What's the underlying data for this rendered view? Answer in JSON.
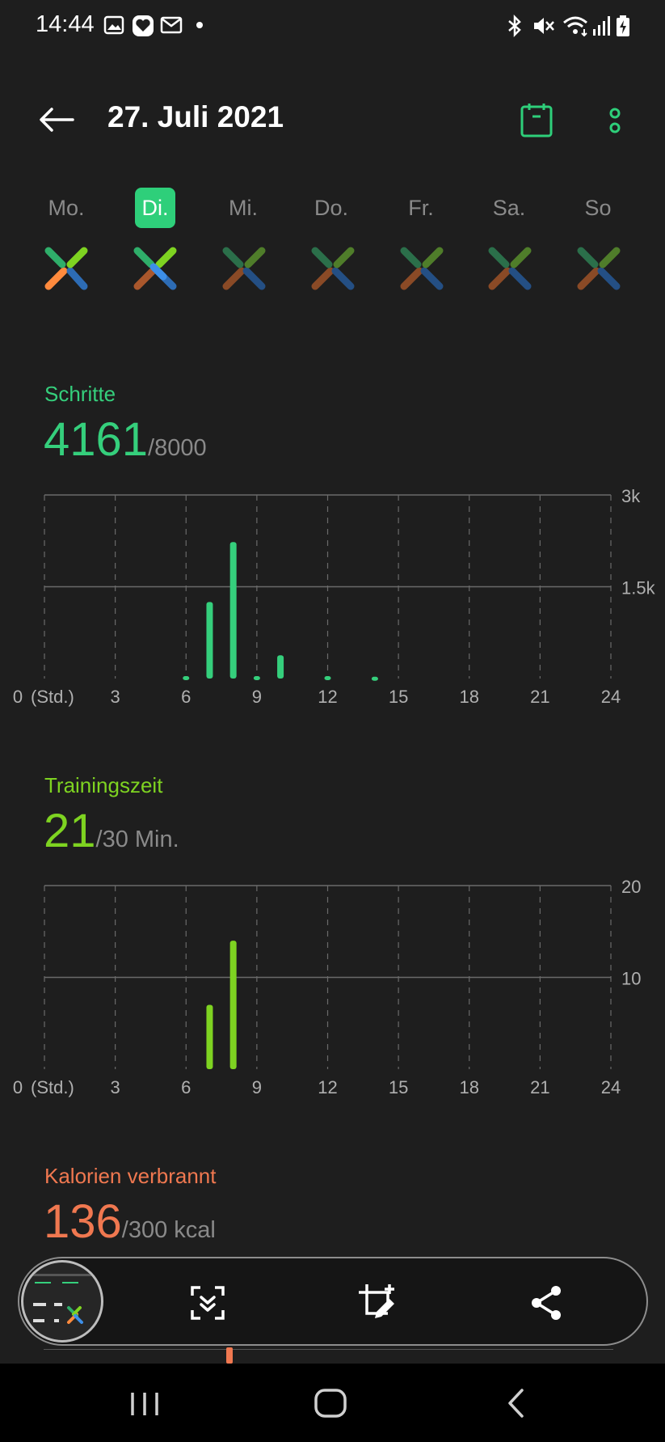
{
  "status": {
    "time": "14:44",
    "left_icons": [
      "image-icon",
      "heart-app-icon",
      "mail-icon",
      "dot-icon"
    ],
    "right_icons": [
      "bluetooth-icon",
      "mute-icon",
      "wifi-icon",
      "signal-icon",
      "battery-charging-icon"
    ]
  },
  "header": {
    "title": "27. Juli 2021",
    "accent": "#2ecf7a"
  },
  "days": [
    {
      "label": "Mo.",
      "selected": false
    },
    {
      "label": "Di.",
      "selected": true
    },
    {
      "label": "Mi.",
      "selected": false
    },
    {
      "label": "Do.",
      "selected": false
    },
    {
      "label": "Fr.",
      "selected": false
    },
    {
      "label": "Sa.",
      "selected": false
    },
    {
      "label": "So",
      "selected": false
    }
  ],
  "steps": {
    "label": "Schritte",
    "value": "4161",
    "goal": "/8000",
    "color": "#35cf7c"
  },
  "training": {
    "label": "Trainingszeit",
    "value": "21",
    "goal": "/30 Min.",
    "color": "#7ed321"
  },
  "calories": {
    "label": "Kalorien verbrannt",
    "value": "136",
    "goal": "/300 kcal",
    "color": "#f07850"
  },
  "chart_data": [
    {
      "type": "bar",
      "name": "Schritte",
      "x_label": "(Std.)",
      "x_ticks": [
        "0",
        "3",
        "6",
        "9",
        "12",
        "15",
        "18",
        "21",
        "24"
      ],
      "y_ticks": [
        "1.5k",
        "3k"
      ],
      "ylim": [
        0,
        3000
      ],
      "x": [
        6,
        7,
        8,
        9,
        10,
        12,
        14
      ],
      "values": [
        40,
        1250,
        2230,
        40,
        380,
        40,
        30
      ],
      "color": "#35cf7c"
    },
    {
      "type": "bar",
      "name": "Trainingszeit",
      "x_label": "(Std.)",
      "x_ticks": [
        "0",
        "3",
        "6",
        "9",
        "12",
        "15",
        "18",
        "21",
        "24"
      ],
      "y_ticks": [
        "10",
        "20"
      ],
      "ylim": [
        0,
        20
      ],
      "x": [
        7,
        8
      ],
      "values": [
        7,
        14
      ],
      "color": "#7ed321"
    }
  ],
  "toolbar": {
    "buttons": [
      "scroll-capture-icon",
      "crop-edit-icon",
      "share-icon"
    ]
  },
  "navbar": {
    "buttons": [
      "recent-apps-icon",
      "home-icon",
      "back-nav-icon"
    ]
  }
}
